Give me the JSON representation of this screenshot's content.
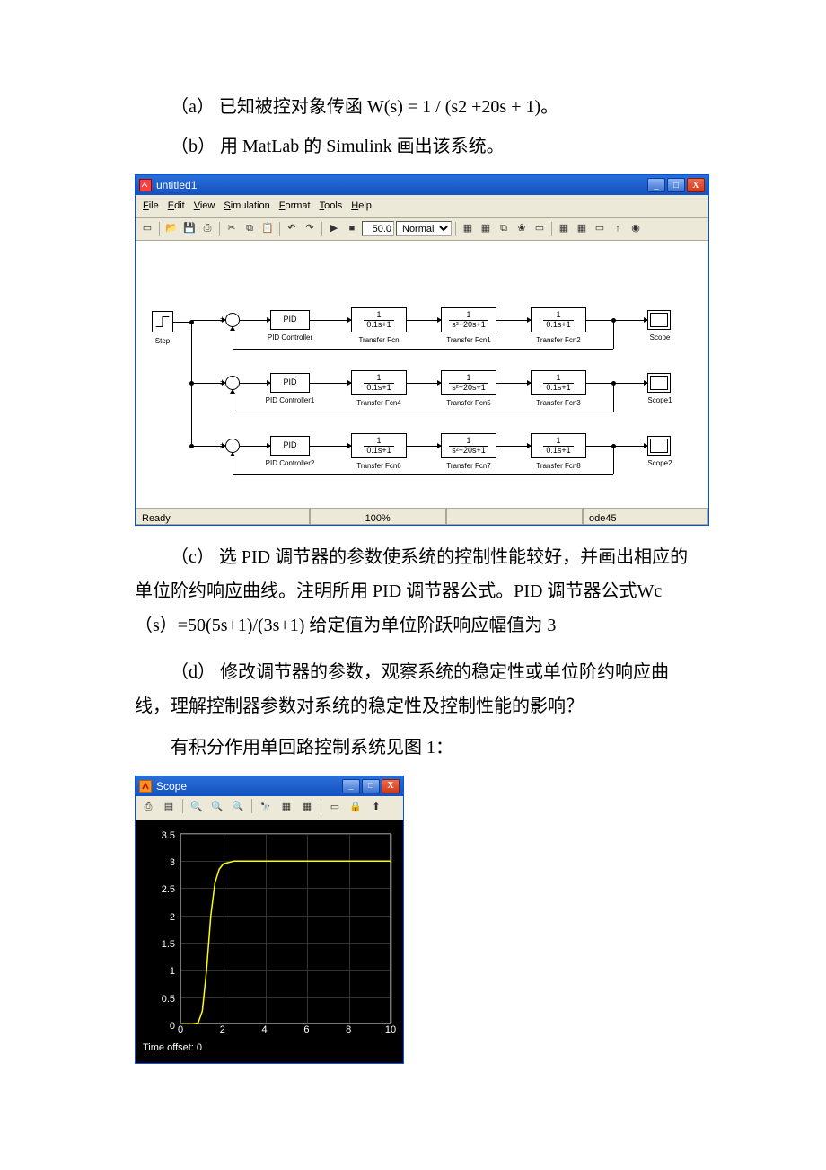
{
  "text": {
    "para_a": "（a） 已知被控对象传函 W(s) = 1 / (s2 +20s + 1)。",
    "para_b": "（b） 用 MatLab 的 Simulink 画出该系统。",
    "para_c": "（c） 选 PID 调节器的参数使系统的控制性能较好，并画出相应的单位阶约响应曲线。注明所用 PID 调节器公式。PID 调节器公式Wc（s）=50(5s+1)/(3s+1) 给定值为单位阶跃响应幅值为 3",
    "para_d": "（d） 修改调节器的参数，观察系统的稳定性或单位阶约响应曲线，理解控制器参数对系统的稳定性及控制性能的影响？",
    "para_e": "有积分作用单回路控制系统见图 1："
  },
  "simulink": {
    "title": "untitled1",
    "menu": [
      "File",
      "Edit",
      "View",
      "Simulation",
      "Format",
      "Tools",
      "Help"
    ],
    "stop_time": "50.0",
    "mode": "Normal",
    "status_ready": "Ready",
    "status_pct": "100%",
    "status_solver": "ode45",
    "winbtns": {
      "min": "_",
      "max": "□",
      "close": "X"
    },
    "rows": [
      {
        "sum_y": 80,
        "pid_label": "PID Controller",
        "tf0": "Transfer Fcn",
        "tf1": "Transfer Fcn1",
        "tf2": "Transfer Fcn2",
        "scope": "Scope"
      },
      {
        "sum_y": 150,
        "pid_label": "PID Controller1",
        "tf0": "Transfer Fcn4",
        "tf1": "Transfer Fcn5",
        "tf2": "Transfer Fcn3",
        "scope": "Scope1"
      },
      {
        "sum_y": 220,
        "pid_label": "PID Controller2",
        "tf0": "Transfer Fcn6",
        "tf1": "Transfer Fcn7",
        "tf2": "Transfer Fcn8",
        "scope": "Scope2"
      }
    ],
    "step_label": "Step",
    "pid_text": "PID",
    "tf_simple": {
      "num": "1",
      "den": "0.1s+1"
    },
    "tf_plant": {
      "num": "1",
      "den": "s²+20s+1"
    }
  },
  "scope": {
    "title": "Scope",
    "winbtns": {
      "min": "_",
      "max": "□",
      "close": "X"
    },
    "time_offset": "Time offset:   0",
    "chart_data": {
      "type": "line",
      "xlabel": "",
      "ylabel": "",
      "xlim": [
        0,
        10
      ],
      "ylim": [
        0,
        3.5
      ],
      "xticks": [
        0,
        2,
        4,
        6,
        8,
        10
      ],
      "yticks": [
        0,
        0.5,
        1,
        1.5,
        2,
        2.5,
        3,
        3.5
      ],
      "series": [
        {
          "name": "response",
          "color": "#ffff00",
          "x": [
            0,
            0.5,
            0.8,
            1.0,
            1.2,
            1.4,
            1.6,
            1.8,
            2.0,
            2.5,
            3.0,
            4.0,
            5.0,
            6.0,
            7.0,
            8.0,
            9.0,
            10.0
          ],
          "y": [
            0,
            0.0,
            0.03,
            0.25,
            1.0,
            2.0,
            2.6,
            2.85,
            2.95,
            3.0,
            3.0,
            3.0,
            3.0,
            3.0,
            3.0,
            3.0,
            3.0,
            3.0
          ]
        }
      ]
    }
  }
}
